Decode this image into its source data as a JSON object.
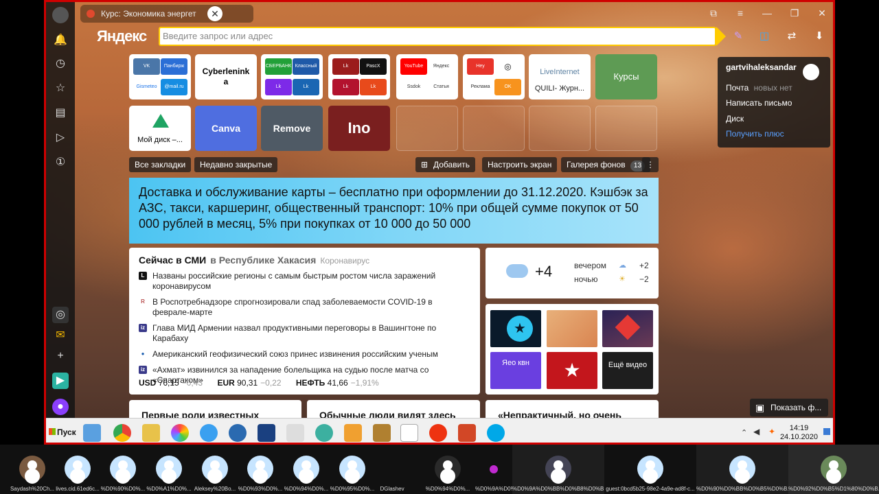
{
  "tab": {
    "title": "Курс: Экономика энергет"
  },
  "brand": "Яндекс",
  "search": {
    "placeholder": "Введите запрос или адрес"
  },
  "tiles_row1": [
    {
      "type": "group",
      "minis": [
        "VK",
        "Панбирж",
        "Gismeteo",
        "@mail.ru"
      ]
    },
    {
      "type": "text",
      "label": "Cyberlenink a"
    },
    {
      "type": "group",
      "minis": [
        "СБЕРБАНК",
        "Классный",
        "Lk",
        "Lk"
      ]
    },
    {
      "type": "group",
      "minis": [
        "Lk",
        "PascX",
        "Lk",
        "Lk"
      ]
    },
    {
      "type": "group",
      "minis": [
        "YouTube",
        "Яндекс",
        "Ssdok",
        "Статья"
      ]
    },
    {
      "type": "group",
      "minis": [
        "Hey",
        "Instagram",
        "Реклама",
        "OK"
      ]
    },
    {
      "type": "text2",
      "label": "LiveInternet",
      "sub": "QUILI- Журн..."
    },
    {
      "type": "color",
      "label": "Курсы"
    }
  ],
  "tiles_row2": [
    {
      "label": "Мой диск –..."
    },
    {
      "label": "Canva"
    },
    {
      "label": "Remove"
    },
    {
      "label": "Ino"
    }
  ],
  "chips": {
    "bookmarks": "Все закладки",
    "recent": "Недавно закрытые",
    "add": "Добавить",
    "configure": "Настроить экран",
    "gallery": "Галерея фонов",
    "gallery_count": "13"
  },
  "banner": {
    "text": "Доставка и обслуживание карты – бесплатно при оформлении до 31.12.2020. Кэшбэк за АЗС, такси, каршеринг, общественный транспорт: 10% при общей сумме покупок от 50 000 рублей в месяц, 5% при покупках от 10 000 до 50 000"
  },
  "news": {
    "title": "Сейчас в СМИ",
    "region": "в Республике Хакасия",
    "tag": "Коронавирус",
    "items": [
      {
        "src": "L",
        "text": "Названы российские регионы с самым быстрым ростом числа заражений коронавирусом"
      },
      {
        "src": "R",
        "text": "В Роспотребнадзоре спрогнозировали спад заболеваемости COVID-19 в феврале-марте"
      },
      {
        "src": "iz",
        "text": "Глава МИД Армении назвал продуктивными переговоры в Вашингтоне по Карабаху"
      },
      {
        "src": "●",
        "text": "Американский геофизический союз принес извинения российским ученым"
      },
      {
        "src": "iz",
        "text": "«Ахмат» извинился за нападение болельщика на судью после матча со «Спартаком»"
      }
    ],
    "rates": [
      {
        "name": "USD",
        "value": "76,15",
        "change": "−0,43"
      },
      {
        "name": "EUR",
        "value": "90,31",
        "change": "−0,22"
      },
      {
        "name": "НЕФТЬ",
        "value": "41,66",
        "change": "−1,91%"
      }
    ]
  },
  "weather": {
    "temp": "+4",
    "evening_label": "вечером",
    "evening_temp": "+2",
    "night_label": "ночью",
    "night_temp": "−2"
  },
  "video": {
    "labels": [
      "",
      "",
      "",
      "Яео квн",
      "",
      "Ещё видео"
    ]
  },
  "cards": [
    "Первые роли известных",
    "Обычные люди видят здесь",
    "«Непрактичный, но очень"
  ],
  "profile": {
    "username": "gartvihaleksandar",
    "mail": "Почта",
    "mail_status": "новых нет",
    "compose": "Написать письмо",
    "disk": "Диск",
    "plus": "Получить плюс"
  },
  "show_button": "Показать ф...",
  "taskbar": {
    "start": "Пуск",
    "time": "14:19",
    "date": "24.10.2020"
  },
  "participants": [
    "Saydash%20Ch...",
    "lives.cid.61ed6c...",
    "%D0%90%D0%...",
    "%D0%A1%D0%...",
    "Aleksey%20Bo...",
    "%D0%93%D0%...",
    "%D0%94%D0%...",
    "%D0%95%D0%...",
    "DGlashev",
    "%D0%94%D0%...",
    "%D0%9A%D0%...",
    "%D0%9A%D0%BB%D0%B8%D0%B...",
    "guest:0bcd5b25-98e2-4a9e-ad8f-c...",
    "%D0%90%D0%BB%D0%B5%D0%B...",
    "%D0%92%D0%B5%D1%80%D0%B..."
  ],
  "colors": {
    "accent": "#ffcc00",
    "frame": "#d00000",
    "banner": "#4cc4f2"
  }
}
